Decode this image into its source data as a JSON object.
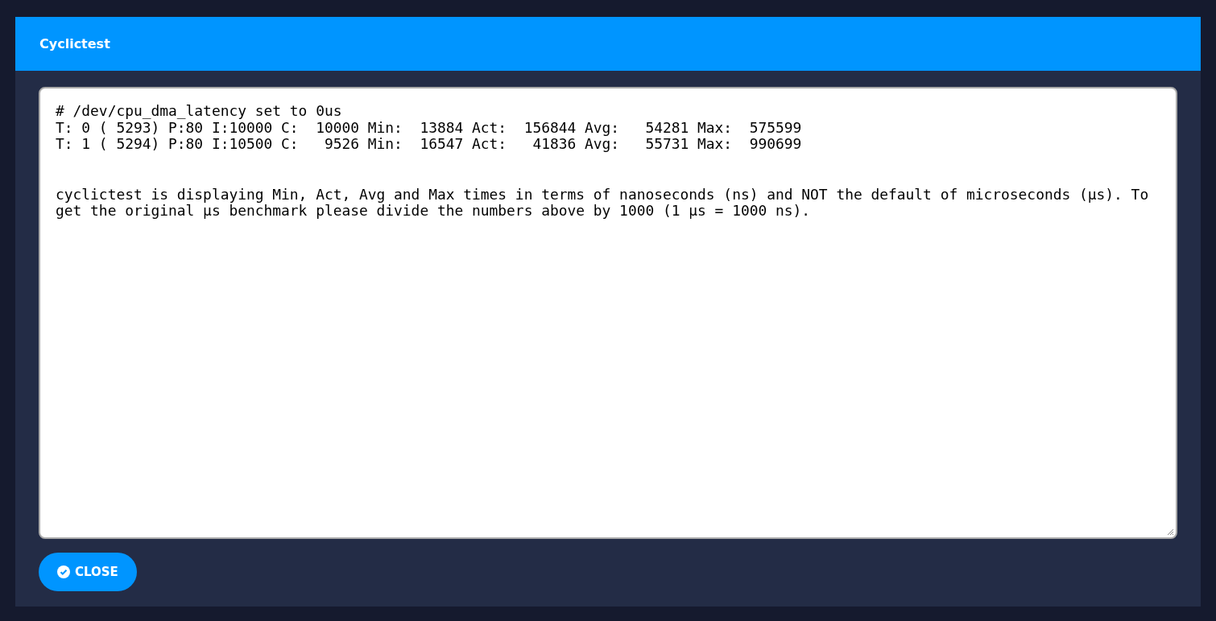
{
  "dialog": {
    "title": "Cyclictest"
  },
  "output": {
    "lines": [
      "# /dev/cpu_dma_latency set to 0us",
      "T: 0 ( 5293) P:80 I:10000 C:  10000 Min:  13884 Act:  156844 Avg:   54281 Max:  575599",
      "T: 1 ( 5294) P:80 I:10500 C:   9526 Min:  16547 Act:   41836 Avg:   55731 Max:  990699"
    ],
    "note": "cyclictest is displaying Min, Act, Avg and Max times in terms of nanoseconds (ns) and NOT the default of microseconds (µs). To get the original µs benchmark please divide the numbers above by 1000 (1 µs = 1000 ns)."
  },
  "buttons": [
    {
      "label": "CLOSE"
    }
  ]
}
